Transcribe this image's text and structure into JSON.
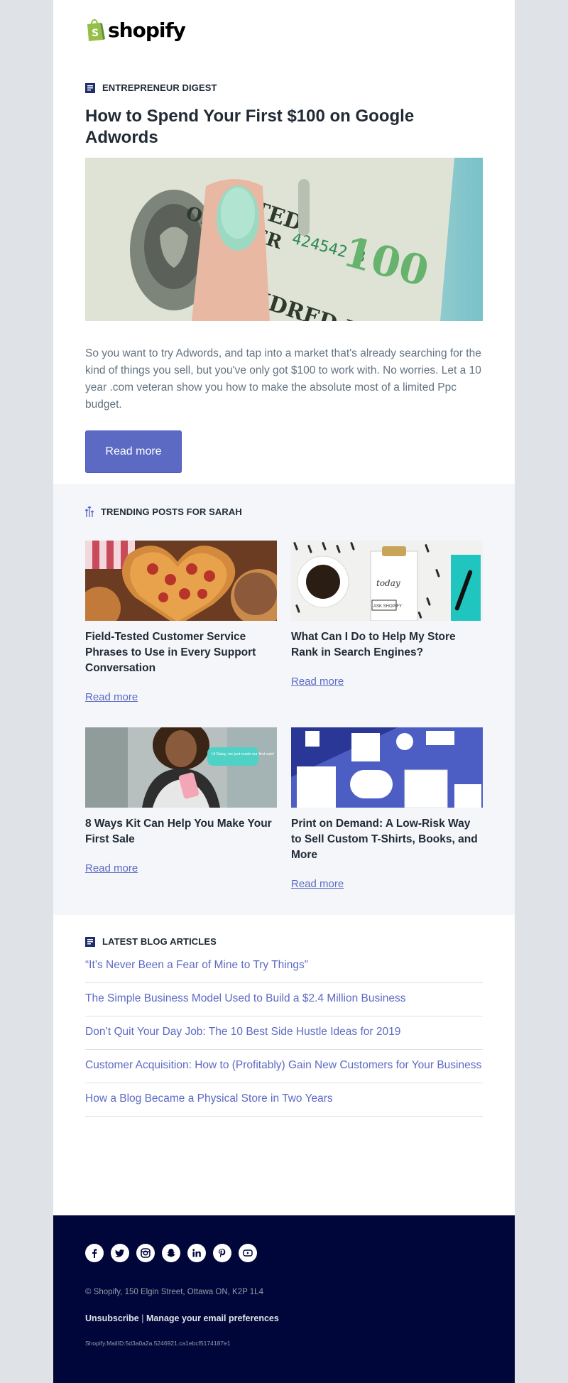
{
  "brand": {
    "name": "shopify",
    "logo_color": "#95bf47"
  },
  "digest": {
    "label": "ENTREPRENEUR DIGEST",
    "headline": "How to Spend Your First $100 on Google Adwords",
    "hero_note_serial": "424542 B",
    "hero_note_value": "100",
    "intro": "So you want to try Adwords, and tap into a market that's already searching for the kind of things you sell, but you've only got $100 to work with.  No worries. Let a 10 year .com veteran show you how to make the absolute most of a limited Ppc budget.",
    "button_label": "Read more"
  },
  "trending": {
    "label": "TRENDING POSTS FOR SARAH",
    "posts": [
      {
        "title": "Field-Tested Customer Service Phrases to Use in Every Support Conversation",
        "link": "Read more"
      },
      {
        "title": "What Can I Do to Help My Store Rank in Search Engines?",
        "link": "Read more",
        "note_today": "today",
        "note_ask": "ASK SHOPIFY"
      },
      {
        "title": "8 Ways Kit Can Help You Make Your First Sale",
        "link": "Read more",
        "bubble": "Hi Daisy, we just made our first sale!"
      },
      {
        "title": "Print on Demand: A Low-Risk Way to Sell Custom T-Shirts, Books, and More",
        "link": "Read more"
      }
    ]
  },
  "latest": {
    "label": "LATEST BLOG ARTICLES",
    "articles": [
      "“It’s Never Been a Fear of Mine to Try Things”",
      "The Simple Business Model Used to Build a $2.4 Million Business",
      "Don’t Quit Your Day Job: The 10 Best Side Hustle Ideas for 2019",
      "Customer Acquisition: How to (Profitably) Gain New Customers for Your Business",
      "How a Blog Became a Physical Store in Two Years"
    ]
  },
  "footer": {
    "social_icons": [
      "facebook-icon",
      "twitter-icon",
      "instagram-icon",
      "snapchat-icon",
      "linkedin-icon",
      "pinterest-icon",
      "youtube-icon"
    ],
    "address": "© Shopify,  150 Elgin Street, Ottawa ON, K2P 1L4",
    "unsubscribe": "Unsubscribe",
    "separator": "|",
    "manage": "Manage your email preferences",
    "mail_id": "Shopify.MailID:5d3a0a2a.5246921.ca1ebcf5174187e1"
  },
  "colors": {
    "accent": "#5c6ac4",
    "footer_bg": "#000639",
    "trending_bg": "#f4f6fa",
    "page_bg": "#dfe3e8"
  }
}
